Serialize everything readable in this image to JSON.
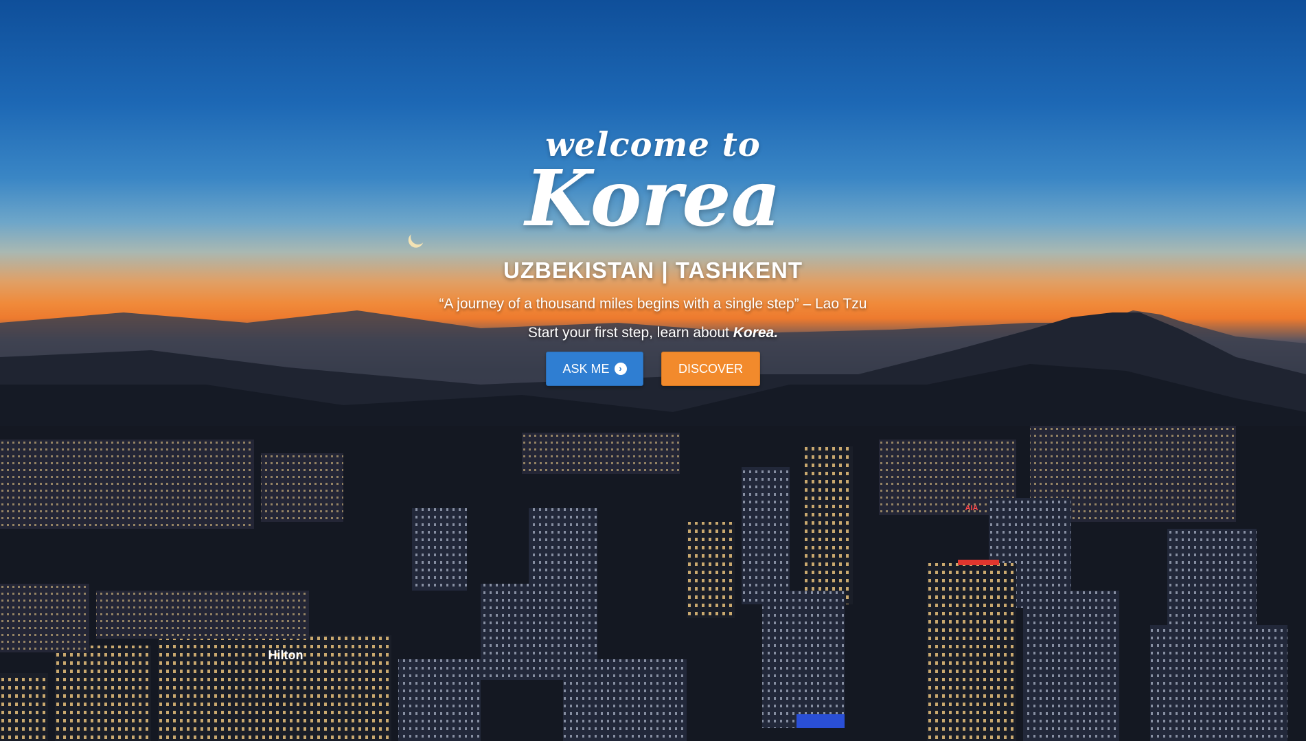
{
  "hero": {
    "welcome": "welcome to",
    "title": "Korea",
    "subtitle": "UZBEKISTAN | TASHKENT",
    "quote": "“A journey of a thousand miles begins with a single step” – Lao Tzu",
    "tagline_prefix": "Start your first step, learn about ",
    "tagline_emphasis": "Korea."
  },
  "buttons": {
    "ask_label": "ASK ME",
    "ask_icon": "chevron-circle-right-icon",
    "discover_label": "DISCOVER"
  },
  "background": {
    "scene": "city-at-dusk",
    "hotel_sign": "Hilton",
    "tower_sign": "AIA"
  },
  "colors": {
    "ask_button": "#2f7ed2",
    "discover_button": "#f28a2c",
    "text": "#ffffff"
  }
}
